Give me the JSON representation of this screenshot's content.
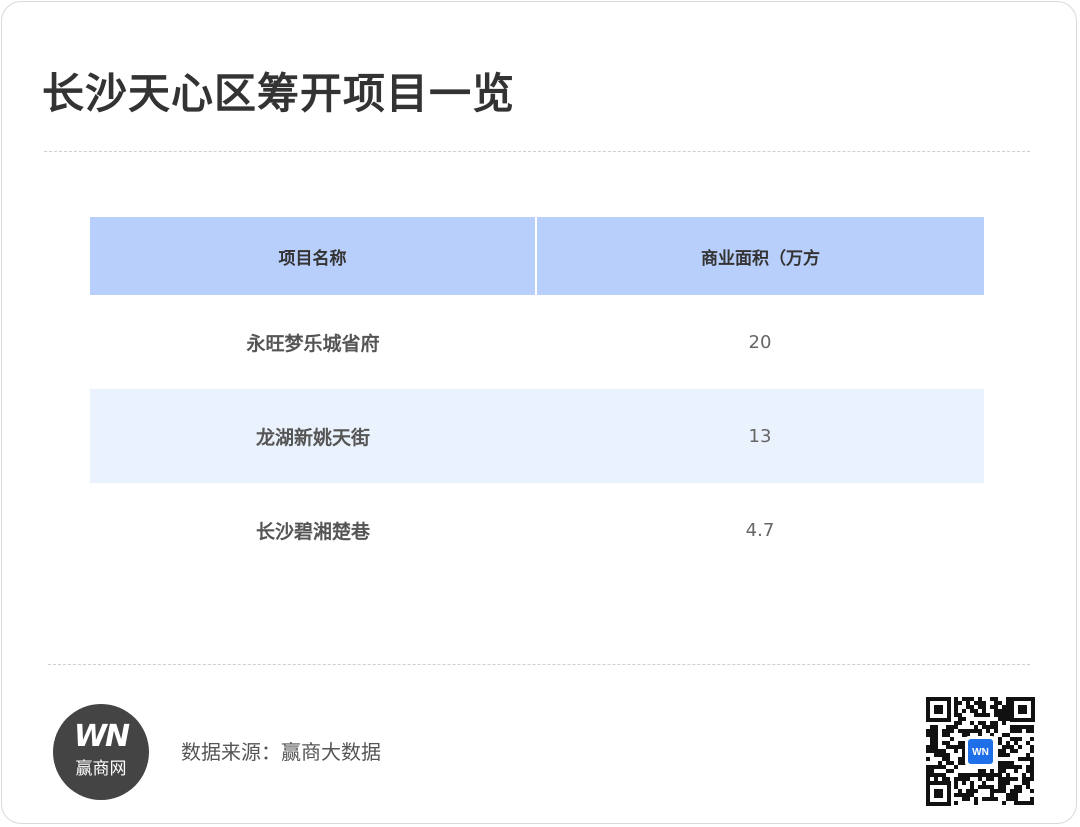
{
  "title": "长沙天心区筹开项目一览",
  "table": {
    "headers": [
      "项目名称",
      "商业面积（万方"
    ],
    "rows": [
      {
        "name": "永旺梦乐城省府",
        "area": "20"
      },
      {
        "name": "龙湖新姚天街",
        "area": "13"
      },
      {
        "name": "长沙碧湘楚巷",
        "area": "4.7"
      }
    ]
  },
  "footer": {
    "logo_mark": "WN",
    "logo_text": "赢商网",
    "source": "数据来源：赢商大数据",
    "qr_badge": "WN"
  },
  "colors": {
    "header_bg": "#b9cffb",
    "alt_row_bg": "#eaf2fd",
    "logo_bg": "#444444",
    "qr_badge": "#1e6fe8"
  }
}
